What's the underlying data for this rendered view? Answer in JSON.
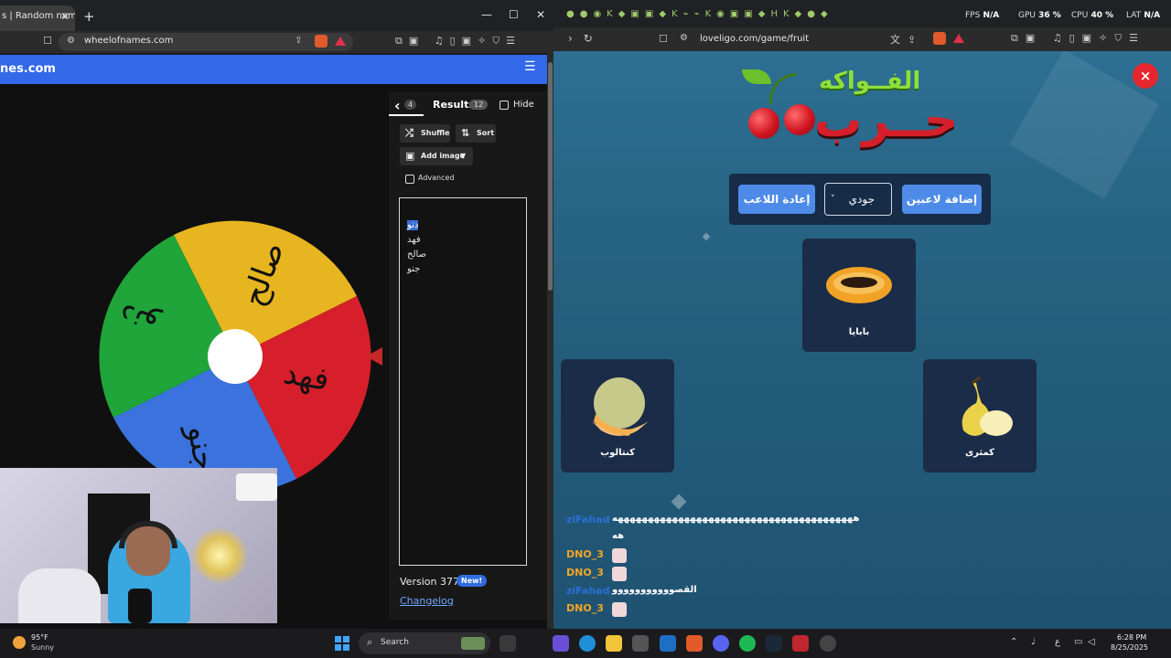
{
  "left_browser": {
    "tab_title": "s | Random name",
    "tab_close": "✕",
    "new_tab": "+",
    "win_min": "—",
    "win_max": "☐",
    "win_close": "✕",
    "url": "wheelofnames.com",
    "site_title": "nes.com",
    "menu_icon": "☰"
  },
  "wheel": {
    "segments": [
      {
        "label": "صالح",
        "color": "#e6b51f"
      },
      {
        "label": "فهد",
        "color": "#d61f2a"
      },
      {
        "label": "جنو",
        "color": "#3b72dd"
      },
      {
        "label": "دنو",
        "color": "#1fa53a"
      }
    ],
    "labels": {
      "yellow": "صالح",
      "red": "فهد",
      "blue": "جنو",
      "green": "دنو"
    }
  },
  "results_panel": {
    "entries_count": "4",
    "results_label": "Results",
    "results_count": "12",
    "hide_label": "Hide",
    "shuffle_label": "Shuffle",
    "sort_label": "Sort",
    "add_image_label": "Add image",
    "advanced_label": "Advanced",
    "entries": [
      "دنو",
      "فهد",
      "صالح",
      "جنو"
    ],
    "version_label": "Version 377",
    "new_badge": "New!",
    "changelog_label": "Changelog"
  },
  "right_browser": {
    "url": "loveligo.com/game/fruit",
    "perf": {
      "fps_label": "FPS",
      "fps_value": "N/A",
      "gpu_label": "GPU",
      "gpu_value": "36 %",
      "cpu_label": "CPU",
      "cpu_value": "40 %",
      "lat_label": "LAT",
      "lat_value": "N/A"
    }
  },
  "game": {
    "logo_top": "الفــواكه",
    "logo_main": "حــرب",
    "close_label": "×",
    "add_players_label": "إضافة لاعبين",
    "reset_player_label": "إعادة اللاعب",
    "selected_player": "جودي",
    "cards": [
      {
        "name": "بابايا",
        "color": "#f1a227"
      },
      {
        "name": "كنتالوب",
        "color": "#f3c07a"
      },
      {
        "name": "كمثرى",
        "color": "#e9d24a"
      }
    ]
  },
  "chat": [
    {
      "name": "ziFahad",
      "name_color": "#2a6fd6",
      "msg": "ههههههههههههههههههههههههههههههههههههههههه"
    },
    {
      "name": "",
      "name_color": "#2a6fd6",
      "msg": "هه"
    },
    {
      "name": "DNO_3",
      "name_color": "#f5a623",
      "msg": ""
    },
    {
      "name": "DNO_3",
      "name_color": "#f5a623",
      "msg": ""
    },
    {
      "name": "ziFahad",
      "name_color": "#2a6fd6",
      "msg": "القصووووووووووو"
    },
    {
      "name": "DNO_3",
      "name_color": "#f5a623",
      "msg": ""
    }
  ],
  "taskbar": {
    "weather_temp": "95°F",
    "weather_cond": "Sunny",
    "search_placeholder": "Search",
    "time": "6:28 PM",
    "date": "8/25/2025",
    "lang": "ع"
  }
}
